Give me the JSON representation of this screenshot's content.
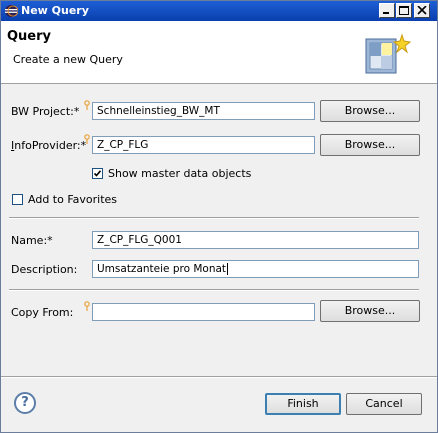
{
  "window": {
    "title": "New Query"
  },
  "banner": {
    "heading": "Query",
    "subtitle": "Create a new Query"
  },
  "form": {
    "bw_project": {
      "label": "BW Project:*",
      "value": "Schnelleinstieg_BW_MT",
      "browse": "Browse..."
    },
    "infoprovider": {
      "label": "InfoProvider:*",
      "value": "Z_CP_FLG",
      "browse": "Browse..."
    },
    "show_master": {
      "label": "Show master data objects",
      "checked": true
    },
    "favorites": {
      "label": "Add to Favorites",
      "checked": false
    },
    "name": {
      "label": "Name:*",
      "value": "Z_CP_FLG_Q001"
    },
    "description": {
      "label": "Description:",
      "value": "Umsatzanteie pro Monat"
    },
    "copy_from": {
      "label": "Copy From:",
      "value": "",
      "browse": "Browse..."
    }
  },
  "footer": {
    "help": "?",
    "finish": "Finish",
    "cancel": "Cancel"
  },
  "colors": {
    "titlebar": "#0a3fae",
    "required_marker": "#e8a33c",
    "field_border": "#7f9db9"
  }
}
